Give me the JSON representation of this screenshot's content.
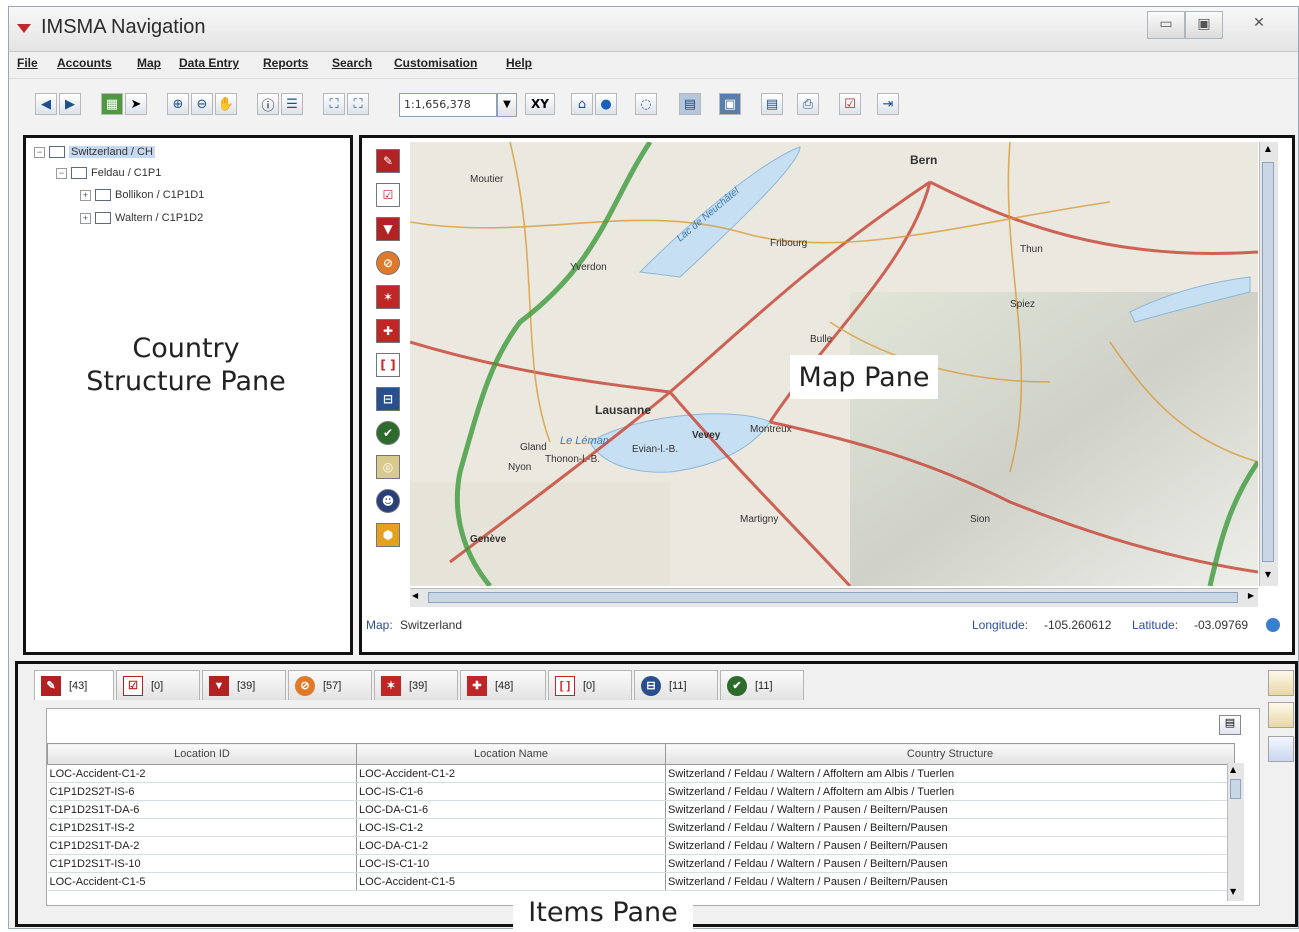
{
  "window": {
    "title": "IMSMA Navigation",
    "minimize_glyph": "▭",
    "maximize_glyph": "▣",
    "close_glyph": "✕"
  },
  "menu": [
    "File",
    "Accounts",
    "Map",
    "Data Entry",
    "Reports",
    "Search",
    "Customisation",
    "Help"
  ],
  "toolbar": {
    "scale_value": "1:1,656,378",
    "xy_label": "XY"
  },
  "tree": {
    "root": "Switzerland / CH",
    "child": "Feldau / C1P1",
    "grandchildren": [
      "Bollikon / C1P1D1",
      "Waltern / C1P1D2"
    ]
  },
  "labels": {
    "country_pane_line1": "Country",
    "country_pane_line2": "Structure Pane",
    "map_pane": "Map Pane",
    "items_pane": "Items Pane"
  },
  "map": {
    "status_map_label": "Map:",
    "status_map_value": "Switzerland",
    "longitude_label": "Longitude:",
    "longitude_value": "-105.260612",
    "latitude_label": "Latitude:",
    "latitude_value": "-03.09769",
    "place_names": [
      "Bern",
      "Lausanne",
      "Le Léman",
      "Vevey",
      "Genève",
      "Montreux",
      "Fribourg",
      "Gland",
      "Nyon",
      "Thonon-l.-B.",
      "Evian-l.-B.",
      "Yverdon",
      "Spiez",
      "Lac de Neuchâtel",
      "Sion",
      "Martigny",
      "Bulle",
      "Moutier",
      "Thun"
    ]
  },
  "item_tabs": [
    {
      "count": "[43]",
      "color": "#b32222",
      "icon": "accident-icon"
    },
    {
      "count": "[0]",
      "color": "#ffffff",
      "icon": "checklist-icon"
    },
    {
      "count": "[39]",
      "color": "#b32222",
      "icon": "hazard-icon"
    },
    {
      "count": "[57]",
      "color": "#e07a2a",
      "icon": "no-entry-icon"
    },
    {
      "count": "[39]",
      "color": "#c02626",
      "icon": "star-icon"
    },
    {
      "count": "[48]",
      "color": "#c02626",
      "icon": "victim-icon"
    },
    {
      "count": "[0]",
      "color": "#ffffff",
      "icon": "bracket-icon"
    },
    {
      "count": "[11]",
      "color": "#2a4f8f",
      "icon": "education-icon"
    },
    {
      "count": "[11]",
      "color": "#2d6b2d",
      "icon": "check-icon"
    }
  ],
  "table": {
    "headers": [
      "Location ID",
      "Location Name",
      "Country Structure"
    ],
    "rows": [
      [
        "LOC-Accident-C1-2",
        "LOC-Accident-C1-2",
        "Switzerland / Feldau / Waltern / Affoltern am Albis / Tuerlen"
      ],
      [
        "C1P1D2S2T-IS-6",
        "LOC-IS-C1-6",
        "Switzerland / Feldau / Waltern / Affoltern am Albis / Tuerlen"
      ],
      [
        "C1P1D2S1T-DA-6",
        "LOC-DA-C1-6",
        "Switzerland / Feldau / Waltern / Pausen / Beiltern/Pausen"
      ],
      [
        "C1P1D2S1T-IS-2",
        "LOC-IS-C1-2",
        "Switzerland / Feldau / Waltern / Pausen / Beiltern/Pausen"
      ],
      [
        "C1P1D2S1T-DA-2",
        "LOC-DA-C1-2",
        "Switzerland / Feldau / Waltern / Pausen / Beiltern/Pausen"
      ],
      [
        "C1P1D2S1T-IS-10",
        "LOC-IS-C1-10",
        "Switzerland / Feldau / Waltern / Pausen / Beiltern/Pausen"
      ],
      [
        "LOC-Accident-C1-5",
        "LOC-Accident-C1-5",
        "Switzerland / Feldau / Waltern / Pausen / Beiltern/Pausen"
      ]
    ]
  }
}
